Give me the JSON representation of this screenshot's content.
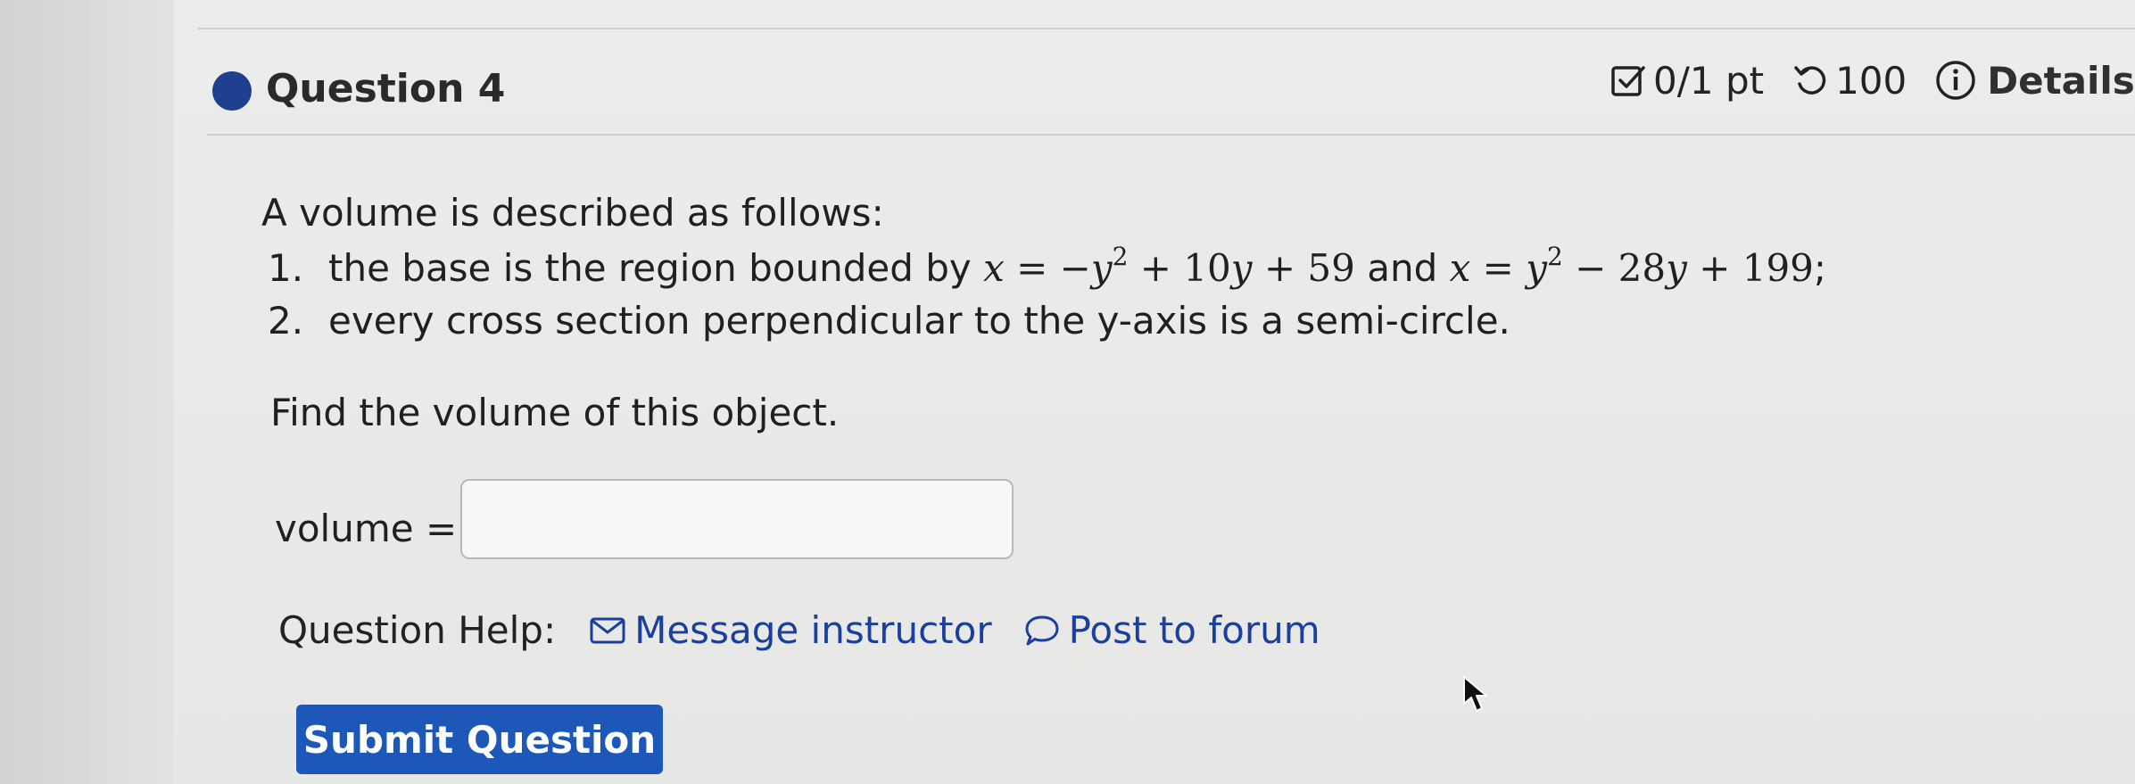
{
  "question": {
    "title": "Question 4",
    "score": "0/1 pt",
    "attempts": "100",
    "details_label": "Details"
  },
  "prompt": {
    "intro": "A volume is described as follows:",
    "items": [
      {
        "number": "1.",
        "text_before": "the base is the region bounded by",
        "eq1": "x = −y² + 10y + 59",
        "joiner": "and",
        "eq2": "x = y² − 28y + 199",
        "end": ";"
      },
      {
        "number": "2.",
        "text": "every cross section perpendicular to the y-axis is a semi-circle."
      }
    ],
    "task": "Find the volume of this object."
  },
  "answer": {
    "label": "volume =",
    "value": "",
    "placeholder": ""
  },
  "help": {
    "label": "Question Help:",
    "message_link": "Message instructor",
    "forum_link": "Post to forum"
  },
  "submit_label": "Submit Question",
  "colors": {
    "accent": "#1d58b9",
    "link": "#1a3f9c",
    "status_dot": "#1f3f8f"
  },
  "icons": [
    "checkbox-icon",
    "retry-icon",
    "info-icon",
    "envelope-icon",
    "speech-bubble-icon",
    "mouse-pointer-icon"
  ]
}
